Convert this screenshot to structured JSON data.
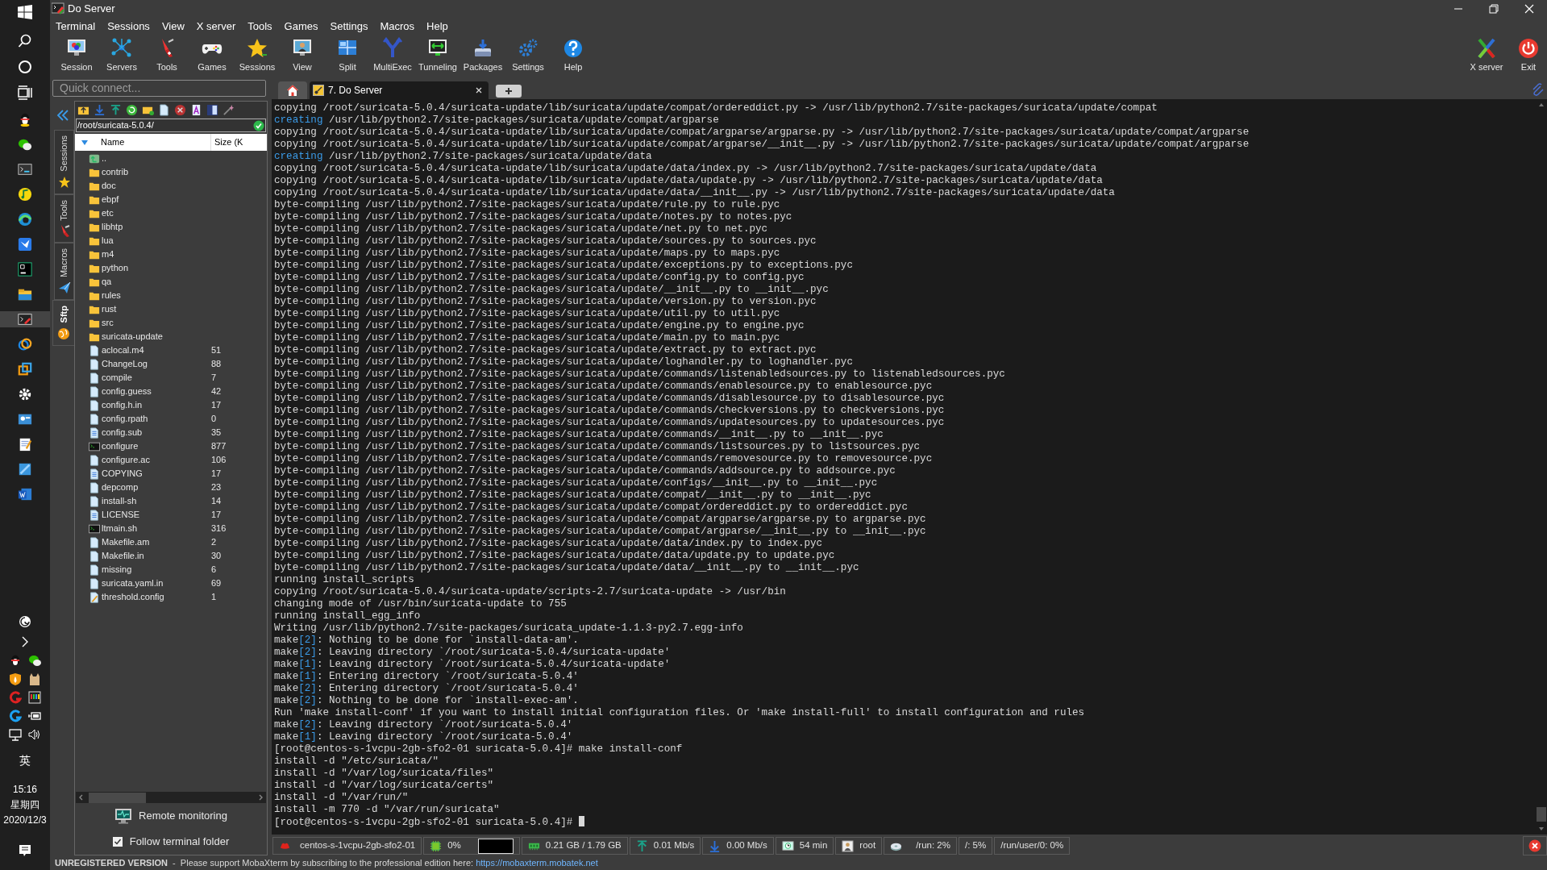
{
  "window": {
    "title": "Do Server"
  },
  "menu": [
    "Terminal",
    "Sessions",
    "View",
    "X server",
    "Tools",
    "Games",
    "Settings",
    "Macros",
    "Help"
  ],
  "toolbar": [
    "Session",
    "Servers",
    "Tools",
    "Games",
    "Sessions",
    "View",
    "Split",
    "MultiExec",
    "Tunneling",
    "Packages",
    "Settings",
    "Help"
  ],
  "toolbar_right": [
    "X server",
    "Exit"
  ],
  "quick_connect": {
    "placeholder": "Quick connect..."
  },
  "side_tabs": [
    {
      "label": "Sessions",
      "selected": false
    },
    {
      "label": "Tools",
      "selected": false
    },
    {
      "label": "Macros",
      "selected": false
    },
    {
      "label": "Sftp",
      "selected": true
    }
  ],
  "sftp": {
    "path": "/root/suricata-5.0.4/",
    "columns": [
      "Name",
      "Size (K"
    ],
    "files": [
      {
        "name": "..",
        "kind": "parent"
      },
      {
        "name": "contrib",
        "kind": "folder"
      },
      {
        "name": "doc",
        "kind": "folder"
      },
      {
        "name": "ebpf",
        "kind": "folder"
      },
      {
        "name": "etc",
        "kind": "folder"
      },
      {
        "name": "libhtp",
        "kind": "folder"
      },
      {
        "name": "lua",
        "kind": "folder"
      },
      {
        "name": "m4",
        "kind": "folder"
      },
      {
        "name": "python",
        "kind": "folder"
      },
      {
        "name": "qa",
        "kind": "folder"
      },
      {
        "name": "rules",
        "kind": "folder"
      },
      {
        "name": "rust",
        "kind": "folder"
      },
      {
        "name": "src",
        "kind": "folder"
      },
      {
        "name": "suricata-update",
        "kind": "folder"
      },
      {
        "name": "aclocal.m4",
        "kind": "file",
        "size": "51"
      },
      {
        "name": "ChangeLog",
        "kind": "file",
        "size": "88"
      },
      {
        "name": "compile",
        "kind": "file",
        "size": "7"
      },
      {
        "name": "config.guess",
        "kind": "file",
        "size": "42"
      },
      {
        "name": "config.h.in",
        "kind": "file",
        "size": "17"
      },
      {
        "name": "config.rpath",
        "kind": "file",
        "size": "0"
      },
      {
        "name": "config.sub",
        "kind": "text",
        "size": "35"
      },
      {
        "name": "configure",
        "kind": "exec",
        "size": "877"
      },
      {
        "name": "configure.ac",
        "kind": "file",
        "size": "106"
      },
      {
        "name": "COPYING",
        "kind": "text",
        "size": "17"
      },
      {
        "name": "depcomp",
        "kind": "file",
        "size": "23"
      },
      {
        "name": "install-sh",
        "kind": "file",
        "size": "14"
      },
      {
        "name": "LICENSE",
        "kind": "text",
        "size": "17"
      },
      {
        "name": "ltmain.sh",
        "kind": "exec",
        "size": "316"
      },
      {
        "name": "Makefile.am",
        "kind": "file",
        "size": "2"
      },
      {
        "name": "Makefile.in",
        "kind": "file",
        "size": "30"
      },
      {
        "name": "missing",
        "kind": "file",
        "size": "6"
      },
      {
        "name": "suricata.yaml.in",
        "kind": "file",
        "size": "69"
      },
      {
        "name": "threshold.config",
        "kind": "edit",
        "size": "1"
      }
    ],
    "remote_monitoring": "Remote monitoring",
    "follow_folder": {
      "label": "Follow terminal folder",
      "checked": true
    }
  },
  "tabs": [
    {
      "kind": "home",
      "selected": false
    },
    {
      "kind": "session",
      "label": "7. Do Server",
      "selected": true
    }
  ],
  "terminal": [
    {
      "kind": "plain",
      "text": "copying /root/suricata-5.0.4/suricata-update/lib/suricata/update/compat/ordereddict.py -> /usr/lib/python2.7/site-packages/suricata/update/compat"
    },
    {
      "kind": "creating",
      "parts": [
        "creating",
        " /usr/lib/python2.7/site-packages/suricata/update/compat/argparse"
      ]
    },
    {
      "kind": "plain",
      "text": "copying /root/suricata-5.0.4/suricata-update/lib/suricata/update/compat/argparse/argparse.py -> /usr/lib/python2.7/site-packages/suricata/update/compat/argparse"
    },
    {
      "kind": "plain",
      "text": "copying /root/suricata-5.0.4/suricata-update/lib/suricata/update/compat/argparse/__init__.py -> /usr/lib/python2.7/site-packages/suricata/update/compat/argparse"
    },
    {
      "kind": "creating",
      "parts": [
        "creating",
        " /usr/lib/python2.7/site-packages/suricata/update/data"
      ]
    },
    {
      "kind": "plain",
      "text": "copying /root/suricata-5.0.4/suricata-update/lib/suricata/update/data/index.py -> /usr/lib/python2.7/site-packages/suricata/update/data"
    },
    {
      "kind": "plain",
      "text": "copying /root/suricata-5.0.4/suricata-update/lib/suricata/update/data/update.py -> /usr/lib/python2.7/site-packages/suricata/update/data"
    },
    {
      "kind": "plain",
      "text": "copying /root/suricata-5.0.4/suricata-update/lib/suricata/update/data/__init__.py -> /usr/lib/python2.7/site-packages/suricata/update/data"
    },
    {
      "kind": "plain",
      "text": "byte-compiling /usr/lib/python2.7/site-packages/suricata/update/rule.py to rule.pyc"
    },
    {
      "kind": "plain",
      "text": "byte-compiling /usr/lib/python2.7/site-packages/suricata/update/notes.py to notes.pyc"
    },
    {
      "kind": "plain",
      "text": "byte-compiling /usr/lib/python2.7/site-packages/suricata/update/net.py to net.pyc"
    },
    {
      "kind": "plain",
      "text": "byte-compiling /usr/lib/python2.7/site-packages/suricata/update/sources.py to sources.pyc"
    },
    {
      "kind": "plain",
      "text": "byte-compiling /usr/lib/python2.7/site-packages/suricata/update/maps.py to maps.pyc"
    },
    {
      "kind": "plain",
      "text": "byte-compiling /usr/lib/python2.7/site-packages/suricata/update/exceptions.py to exceptions.pyc"
    },
    {
      "kind": "plain",
      "text": "byte-compiling /usr/lib/python2.7/site-packages/suricata/update/config.py to config.pyc"
    },
    {
      "kind": "plain",
      "text": "byte-compiling /usr/lib/python2.7/site-packages/suricata/update/__init__.py to __init__.pyc"
    },
    {
      "kind": "plain",
      "text": "byte-compiling /usr/lib/python2.7/site-packages/suricata/update/version.py to version.pyc"
    },
    {
      "kind": "plain",
      "text": "byte-compiling /usr/lib/python2.7/site-packages/suricata/update/util.py to util.pyc"
    },
    {
      "kind": "plain",
      "text": "byte-compiling /usr/lib/python2.7/site-packages/suricata/update/engine.py to engine.pyc"
    },
    {
      "kind": "plain",
      "text": "byte-compiling /usr/lib/python2.7/site-packages/suricata/update/main.py to main.pyc"
    },
    {
      "kind": "plain",
      "text": "byte-compiling /usr/lib/python2.7/site-packages/suricata/update/extract.py to extract.pyc"
    },
    {
      "kind": "plain",
      "text": "byte-compiling /usr/lib/python2.7/site-packages/suricata/update/loghandler.py to loghandler.pyc"
    },
    {
      "kind": "plain",
      "text": "byte-compiling /usr/lib/python2.7/site-packages/suricata/update/commands/listenabledsources.py to listenabledsources.pyc"
    },
    {
      "kind": "plain",
      "text": "byte-compiling /usr/lib/python2.7/site-packages/suricata/update/commands/enablesource.py to enablesource.pyc"
    },
    {
      "kind": "plain",
      "text": "byte-compiling /usr/lib/python2.7/site-packages/suricata/update/commands/disablesource.py to disablesource.pyc"
    },
    {
      "kind": "plain",
      "text": "byte-compiling /usr/lib/python2.7/site-packages/suricata/update/commands/checkversions.py to checkversions.pyc"
    },
    {
      "kind": "plain",
      "text": "byte-compiling /usr/lib/python2.7/site-packages/suricata/update/commands/updatesources.py to updatesources.pyc"
    },
    {
      "kind": "plain",
      "text": "byte-compiling /usr/lib/python2.7/site-packages/suricata/update/commands/__init__.py to __init__.pyc"
    },
    {
      "kind": "plain",
      "text": "byte-compiling /usr/lib/python2.7/site-packages/suricata/update/commands/listsources.py to listsources.pyc"
    },
    {
      "kind": "plain",
      "text": "byte-compiling /usr/lib/python2.7/site-packages/suricata/update/commands/removesource.py to removesource.pyc"
    },
    {
      "kind": "plain",
      "text": "byte-compiling /usr/lib/python2.7/site-packages/suricata/update/commands/addsource.py to addsource.pyc"
    },
    {
      "kind": "plain",
      "text": "byte-compiling /usr/lib/python2.7/site-packages/suricata/update/configs/__init__.py to __init__.pyc"
    },
    {
      "kind": "plain",
      "text": "byte-compiling /usr/lib/python2.7/site-packages/suricata/update/compat/__init__.py to __init__.pyc"
    },
    {
      "kind": "plain",
      "text": "byte-compiling /usr/lib/python2.7/site-packages/suricata/update/compat/ordereddict.py to ordereddict.pyc"
    },
    {
      "kind": "plain",
      "text": "byte-compiling /usr/lib/python2.7/site-packages/suricata/update/compat/argparse/argparse.py to argparse.pyc"
    },
    {
      "kind": "plain",
      "text": "byte-compiling /usr/lib/python2.7/site-packages/suricata/update/compat/argparse/__init__.py to __init__.pyc"
    },
    {
      "kind": "plain",
      "text": "byte-compiling /usr/lib/python2.7/site-packages/suricata/update/data/index.py to index.pyc"
    },
    {
      "kind": "plain",
      "text": "byte-compiling /usr/lib/python2.7/site-packages/suricata/update/data/update.py to update.pyc"
    },
    {
      "kind": "plain",
      "text": "byte-compiling /usr/lib/python2.7/site-packages/suricata/update/data/__init__.py to __init__.pyc"
    },
    {
      "kind": "plain",
      "text": "running install_scripts"
    },
    {
      "kind": "plain",
      "text": "copying /root/suricata-5.0.4/suricata-update/scripts-2.7/suricata-update -> /usr/bin"
    },
    {
      "kind": "plain",
      "text": "changing mode of /usr/bin/suricata-update to 755"
    },
    {
      "kind": "plain",
      "text": "running install_egg_info"
    },
    {
      "kind": "plain",
      "text": "Writing /usr/lib/python2.7/site-packages/suricata_update-1.1.3-py2.7.egg-info"
    },
    {
      "kind": "make",
      "parts": [
        "make",
        "[2]",
        ": Nothing to be done for `install-data-am'."
      ]
    },
    {
      "kind": "make",
      "parts": [
        "make",
        "[2]",
        ": Leaving directory `/root/suricata-5.0.4/suricata-update'"
      ]
    },
    {
      "kind": "make",
      "parts": [
        "make",
        "[1]",
        ": Leaving directory `/root/suricata-5.0.4/suricata-update'"
      ]
    },
    {
      "kind": "make",
      "parts": [
        "make",
        "[1]",
        ": Entering directory `/root/suricata-5.0.4'"
      ]
    },
    {
      "kind": "make",
      "parts": [
        "make",
        "[2]",
        ": Entering directory `/root/suricata-5.0.4'"
      ]
    },
    {
      "kind": "make",
      "parts": [
        "make",
        "[2]",
        ": Nothing to be done for `install-exec-am'."
      ]
    },
    {
      "kind": "plain",
      "text": "Run 'make install-conf' if you want to install initial configuration files. Or 'make install-full' to install configuration and rules"
    },
    {
      "kind": "make",
      "parts": [
        "make",
        "[2]",
        ": Leaving directory `/root/suricata-5.0.4'"
      ]
    },
    {
      "kind": "make",
      "parts": [
        "make",
        "[1]",
        ": Leaving directory `/root/suricata-5.0.4'"
      ]
    },
    {
      "kind": "plain",
      "text": "[root@centos-s-1vcpu-2gb-sfo2-01 suricata-5.0.4]# make install-conf"
    },
    {
      "kind": "plain",
      "text": "install -d \"/etc/suricata/\""
    },
    {
      "kind": "plain",
      "text": "install -d \"/var/log/suricata/files\""
    },
    {
      "kind": "plain",
      "text": "install -d \"/var/log/suricata/certs\""
    },
    {
      "kind": "plain",
      "text": "install -d \"/var/run/\""
    },
    {
      "kind": "plain",
      "text": "install -m 770 -d \"/var/run/suricata\""
    },
    {
      "kind": "cursor",
      "text": "[root@centos-s-1vcpu-2gb-sfo2-01 suricata-5.0.4]# "
    }
  ],
  "status_bar": [
    {
      "kind": "host",
      "text": "centos-s-1vcpu-2gb-sfo2-01"
    },
    {
      "kind": "cpu",
      "text": "0%"
    },
    {
      "kind": "memory",
      "text": "0.21 GB / 1.79 GB"
    },
    {
      "kind": "upload",
      "text": "0.01 Mb/s"
    },
    {
      "kind": "download",
      "text": "0.00 Mb/s"
    },
    {
      "kind": "uptime",
      "text": "54 min"
    },
    {
      "kind": "user",
      "text": "root"
    },
    {
      "kind": "disk",
      "text": "/run: 2%"
    },
    {
      "kind": "plain",
      "text": "/: 5%"
    },
    {
      "kind": "plain",
      "text": "/run/user/0: 0%"
    }
  ],
  "notice": {
    "text": "**UNREGISTERED VERSION**  -  Please support MobaXterm by subscribing to the professional edition here: ",
    "link": "https://mobaxterm.mobatek.net"
  },
  "taskbar": {
    "input_method": "英",
    "time": "15:16",
    "weekday": "星期四",
    "date": "2020/12/3"
  }
}
